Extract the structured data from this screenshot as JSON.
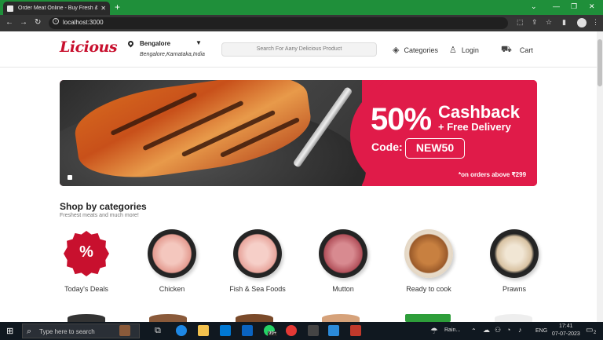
{
  "browser": {
    "tab_title": "Order Meat Online - Buy Fresh & ...",
    "tab_close": "✕",
    "new_tab": "+",
    "url": "localhost:3000",
    "win_min": "—",
    "win_max": "❐",
    "win_close": "✕",
    "chevron": "⌄"
  },
  "header": {
    "logo": "Licious",
    "location_city": "Bengalore",
    "location_full": "Bengalore,Karnataka,India",
    "search_placeholder": "Search For Aany Delicious Product",
    "categories_label": "Categories",
    "login_label": "Login",
    "cart_label": "Cart"
  },
  "banner": {
    "percent": "50%",
    "headline": "Cashback",
    "subline": "+ Free Delivery",
    "code_label": "Code:",
    "code": "NEW50",
    "fine_print": "*on orders above ₹299"
  },
  "categories": {
    "title": "Shop by categories",
    "subtitle": "Freshest meats and much more!",
    "items": [
      {
        "label": "Today's Deals",
        "icon": "deal-badge-icon",
        "color": "#c8102e"
      },
      {
        "label": "Chicken",
        "icon": "chicken-icon",
        "color": "#f0b9b0"
      },
      {
        "label": "Fish & Sea Foods",
        "icon": "fish-icon",
        "color": "#f2c1bb"
      },
      {
        "label": "Mutton",
        "icon": "mutton-icon",
        "color": "#c96b75"
      },
      {
        "label": "Ready to cook",
        "icon": "ready-to-cook-icon",
        "color": "#b8743a"
      },
      {
        "label": "Prawns",
        "icon": "prawns-icon",
        "color": "#e8d8c0"
      }
    ],
    "deal_symbol": "%"
  },
  "taskbar": {
    "search_text": "Type here to search",
    "weather": "Rain...",
    "lang": "ENG",
    "time": "17:41",
    "date": "07-07-2023",
    "notif_count": "2",
    "badge": "99+"
  },
  "colors": {
    "brand": "#c8102e",
    "banner_pink": "#e01b49",
    "tabbar_green": "#1f8f3a"
  }
}
